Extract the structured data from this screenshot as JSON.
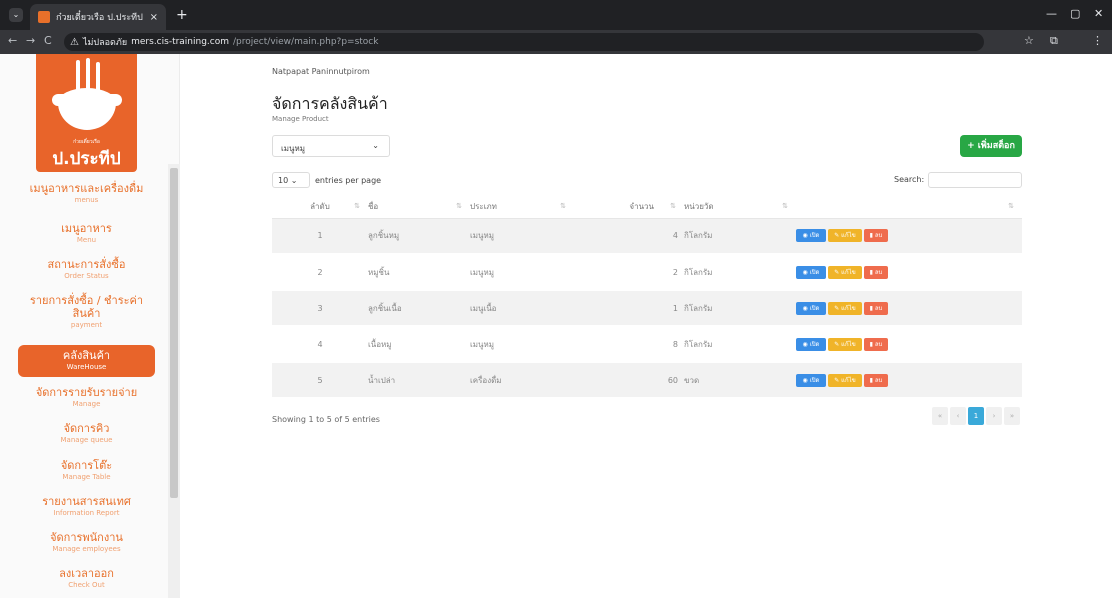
{
  "browser": {
    "tab_title": "ก๋วยเตี๋ยวเรือ ป.ประทีป สาขาวัดแพนอง",
    "tab_close": "×",
    "new_tab": "+",
    "tab_menu": "⌄",
    "back": "←",
    "forward": "→",
    "reload": "C",
    "warning_icon": "⚠",
    "insecure_label": "ไม่ปลอดภัย",
    "host": "mers.cis-training.com",
    "path": "/project/view/main.php?p=stock",
    "star": "☆",
    "ext": "⧉",
    "menu": "⋮",
    "minimize": "—",
    "maximize": "▢",
    "close": "✕"
  },
  "logo": {
    "small_text": "ก๋วยเตี๋ยวเรือ",
    "name": "ป.ประทีป"
  },
  "sidebar": {
    "items": [
      {
        "th": "เมนูอาหารและเครื่องดื่ม",
        "en": "menus"
      },
      {
        "th": "เมนูอาหาร",
        "en": "Menu"
      },
      {
        "th": "สถานะการสั่งซื้อ",
        "en": "Order Status"
      },
      {
        "th": "รายการสั่งซื้อ / ชำระค่า",
        "th2": "สินค้า",
        "en": "payment"
      },
      {
        "th": "คลังสินค้า",
        "en": "WareHouse"
      },
      {
        "th": "จัดการรายรับรายจ่าย",
        "en": "Manage"
      },
      {
        "th": "จัดการคิว",
        "en": "Manage queue"
      },
      {
        "th": "จัดการโต๊ะ",
        "en": "Manage Table"
      },
      {
        "th": "รายงานสารสนเทศ",
        "en": "Information Report"
      },
      {
        "th": "จัดการพนักงาน",
        "en": "Manage employees"
      },
      {
        "th": "ลงเวลาออก",
        "en": "Check Out"
      }
    ]
  },
  "main": {
    "user": "Natpapat Paninnutpirom",
    "title": "จัดการคลังสินค้า",
    "subtitle": "Manage Product",
    "category_select": "เมนูหมู",
    "select_chevron": "⌄",
    "add_button": "+ เพิ่มสต็อก",
    "entries_value": "10",
    "entries_chevron": "⌄",
    "entries_label": "entries per page",
    "search_label": "Search:",
    "columns": [
      "ลำดับ",
      "ชื่อ",
      "ประเภท",
      "จำนวน",
      "หน่วยวัด",
      ""
    ],
    "rows": [
      {
        "no": "1",
        "name": "ลูกชิ้นหมู",
        "type": "เมนูหมู",
        "qty": "4",
        "unit": "กิโลกรัม"
      },
      {
        "no": "2",
        "name": "หมูชิ้น",
        "type": "เมนูหมู",
        "qty": "2",
        "unit": "กิโลกรัม"
      },
      {
        "no": "3",
        "name": "ลูกชิ้นเนื้อ",
        "type": "เมนูเนื้อ",
        "qty": "1",
        "unit": "กิโลกรัม"
      },
      {
        "no": "4",
        "name": "เนื้อหมู",
        "type": "เมนูหมู",
        "qty": "8",
        "unit": "กิโลกรัม"
      },
      {
        "no": "5",
        "name": "น้ำเปล่า",
        "type": "เครื่องดื่ม",
        "qty": "60",
        "unit": "ขวด"
      }
    ],
    "btn_open": "◉ เปิด",
    "btn_edit": "✎ แก้ไข",
    "btn_delete": "▮ ลบ",
    "info": "Showing 1 to 5 of 5 entries",
    "pager": [
      "«",
      "‹",
      "1",
      "›",
      "»"
    ]
  }
}
